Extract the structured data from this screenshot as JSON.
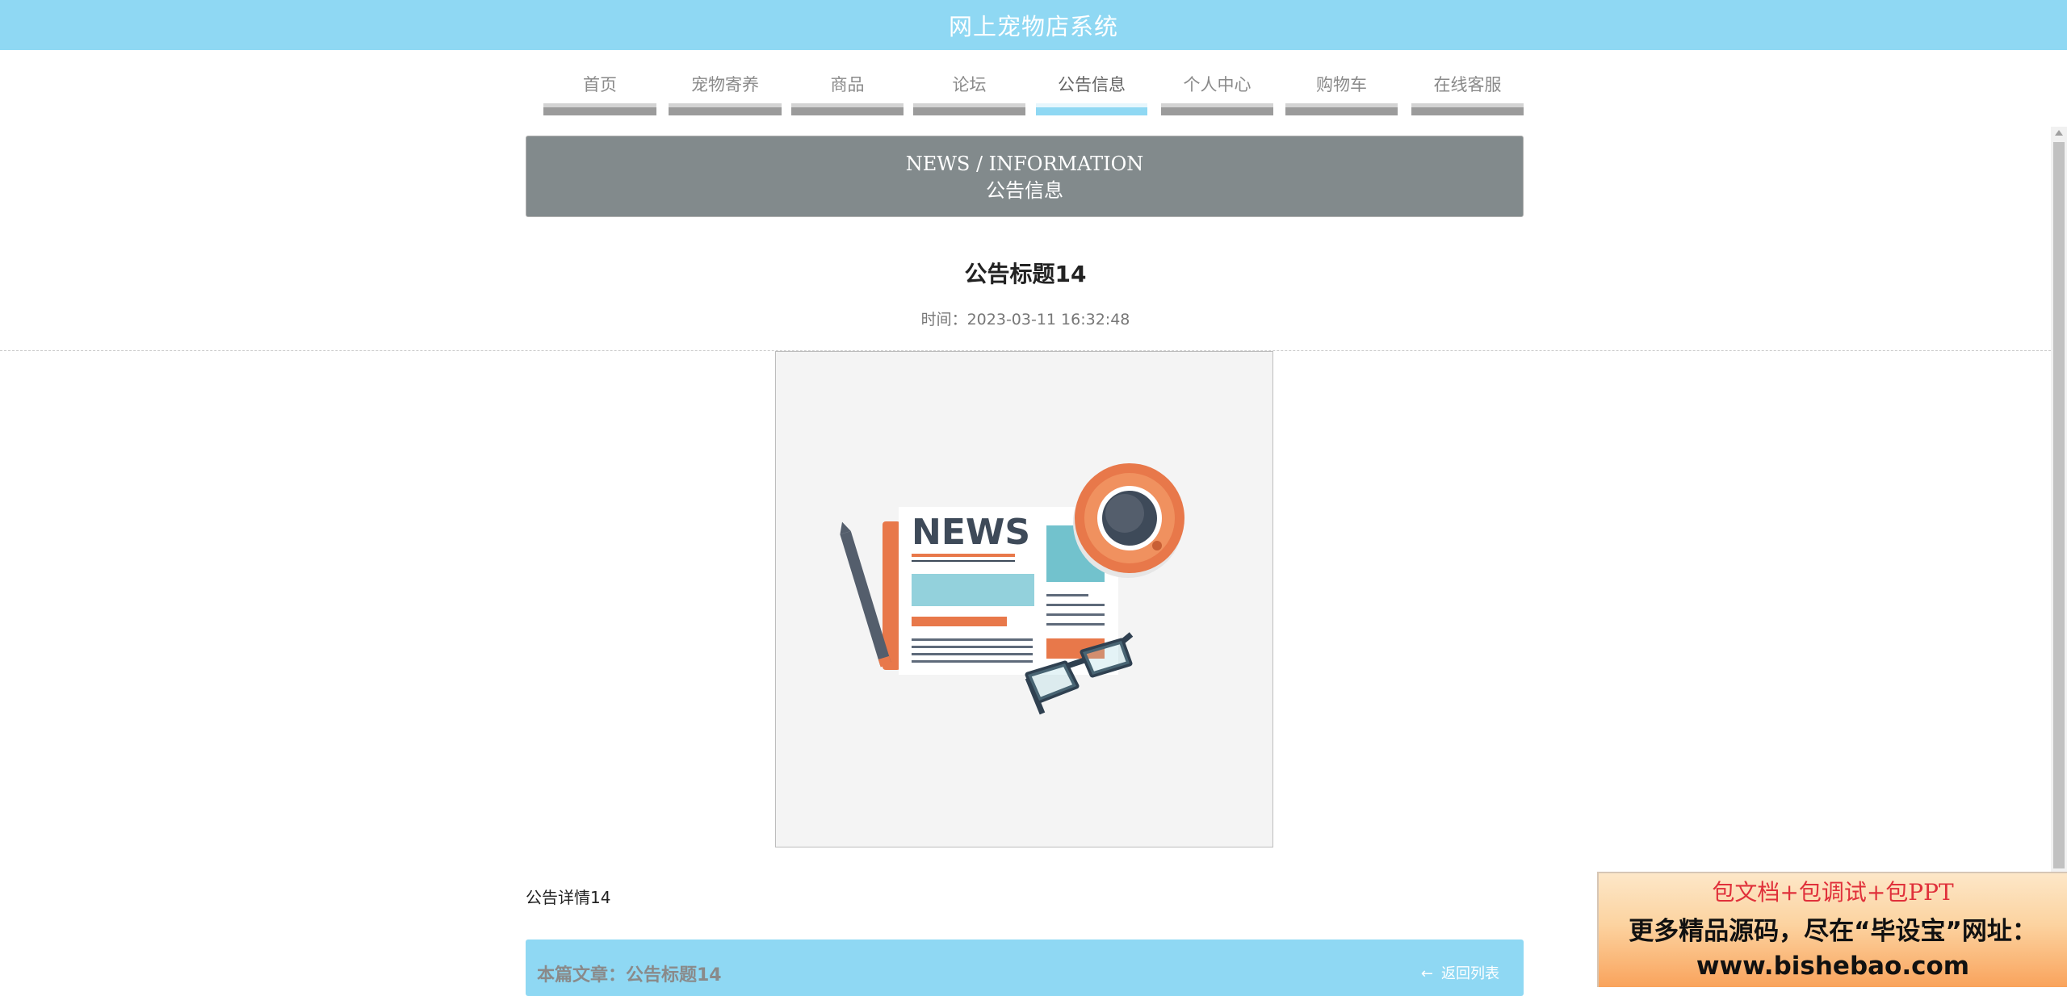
{
  "site": {
    "title": "网上宠物店系统"
  },
  "nav": {
    "items": [
      {
        "label": "首页",
        "active": false
      },
      {
        "label": "宠物寄养",
        "active": false
      },
      {
        "label": "商品",
        "active": false
      },
      {
        "label": "论坛",
        "active": false
      },
      {
        "label": "公告信息",
        "active": true
      },
      {
        "label": "个人中心",
        "active": false
      },
      {
        "label": "购物车",
        "active": false
      },
      {
        "label": "在线客服",
        "active": false
      }
    ]
  },
  "banner": {
    "en": "NEWS / INFORMATION",
    "zh": "公告信息"
  },
  "article": {
    "title": "公告标题14",
    "time": "时间：2023-03-11 16:32:48",
    "image_alt_icon": "news-illustration",
    "detail": "公告详情14"
  },
  "footer": {
    "current": "本篇文章：公告标题14",
    "back_label": "返回列表",
    "back_icon": "arrow-left-icon"
  },
  "ad": {
    "line1": "包文档+包调试+包PPT",
    "line2": "更多精品源码，尽在“毕设宝”网址：",
    "line3": "www.bishebao.com"
  },
  "colors": {
    "accent": "#8fd8f3",
    "banner_bg": "#828a8c",
    "nav_bar": "#9b9b9b"
  }
}
